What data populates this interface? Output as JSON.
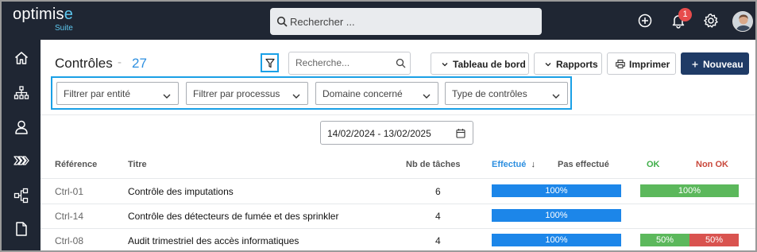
{
  "app": {
    "logo_main_a": "optimis",
    "logo_main_b": "e",
    "logo_sub": "Suite",
    "global_search_placeholder": "Rechercher ...",
    "notification_count": "1"
  },
  "icons": {
    "topbar": [
      "search-icon",
      "plus-circle-icon",
      "bell-icon",
      "gear-icon",
      "user-avatar"
    ],
    "sidebar": [
      "home-icon",
      "org-chart-icon",
      "user-icon",
      "process-chevrons-icon",
      "hierarchy-icon",
      "document-icon"
    ]
  },
  "page": {
    "title": "Contrôles",
    "separator": "-",
    "count": "27"
  },
  "toolbar": {
    "search_placeholder": "Recherche...",
    "dashboard_label": "Tableau de bord",
    "reports_label": "Rapports",
    "print_label": "Imprimer",
    "new_label": "Nouveau"
  },
  "filters": [
    {
      "label": "Filtrer par entité"
    },
    {
      "label": "Filtrer par processus"
    },
    {
      "label": "Domaine concerné"
    },
    {
      "label": "Type de contrôles"
    }
  ],
  "date_range": "14/02/2024 - 13/02/2025",
  "table": {
    "headers": {
      "reference": "Référence",
      "titre": "Titre",
      "nb_taches": "Nb de tâches",
      "effectue": "Effectué",
      "sort_arrow": "↓",
      "pas_effectue": "Pas effectué",
      "ok": "OK",
      "non_ok": "Non OK"
    },
    "rows": [
      {
        "ref": "Ctrl-01",
        "titre": "Contrôle des imputations",
        "nb": "6",
        "effectue_pct": 100,
        "effectue_label": "100%",
        "ok_pct": 100,
        "ok_label": "100%",
        "nonok_pct": 0,
        "nonok_label": ""
      },
      {
        "ref": "Ctrl-14",
        "titre": "Contrôle des détecteurs de fumée et des sprinkler",
        "nb": "4",
        "effectue_pct": 100,
        "effectue_label": "100%",
        "ok_pct": 0,
        "ok_label": "",
        "nonok_pct": 0,
        "nonok_label": ""
      },
      {
        "ref": "Ctrl-08",
        "titre": "Audit trimestriel des accès informatiques",
        "nb": "4",
        "effectue_pct": 100,
        "effectue_label": "100%",
        "ok_pct": 50,
        "ok_label": "50%",
        "nonok_pct": 50,
        "nonok_label": "50%"
      }
    ]
  },
  "colors": {
    "topbar": "#1f2633",
    "accent": "#2d8fe0",
    "highlight": "#1aa0e6",
    "progress_blue": "#1c86e9",
    "ok_green": "#5cb85c",
    "nonok_red": "#d9534f",
    "primary_button": "#1f3b66"
  }
}
